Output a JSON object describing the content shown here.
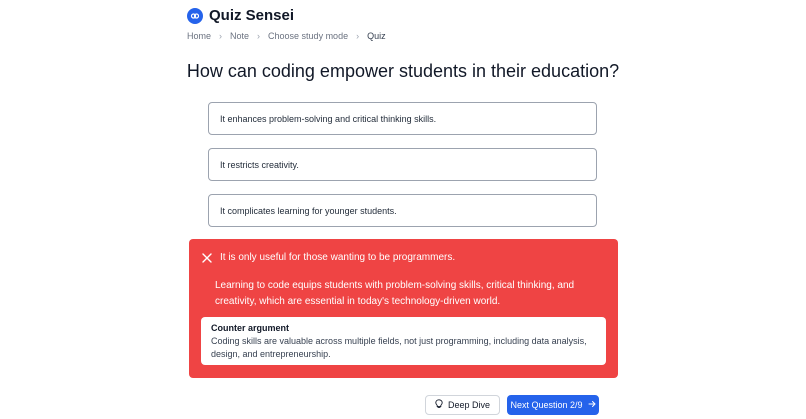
{
  "brand": {
    "name": "Quiz Sensei",
    "logo_icon": "brain-logo-icon"
  },
  "breadcrumb": [
    "Home",
    "Note",
    "Choose study mode",
    "Quiz"
  ],
  "question": "How can coding empower students in their education?",
  "options": [
    "It enhances problem-solving and critical thinking skills.",
    "It restricts creativity.",
    "It complicates learning for younger students."
  ],
  "feedback": {
    "selected_answer": "It is only useful for those wanting to be programmers.",
    "status_icon": "close-icon",
    "explanation": "Learning to code equips students with problem-solving skills, critical thinking, and creativity, which are essential in today's technology-driven world.",
    "counter_title": "Counter argument",
    "counter_text": "Coding skills are valuable across multiple fields, not just programming, including data analysis, design, and entrepreneurship."
  },
  "actions": {
    "deep_dive_label": "Deep Dive",
    "deep_dive_icon": "lightbulb-icon",
    "next_label": "Next Question 2/9",
    "next_icon": "arrow-right-icon"
  },
  "colors": {
    "accent": "#2563eb",
    "wrong": "#ef4444"
  }
}
